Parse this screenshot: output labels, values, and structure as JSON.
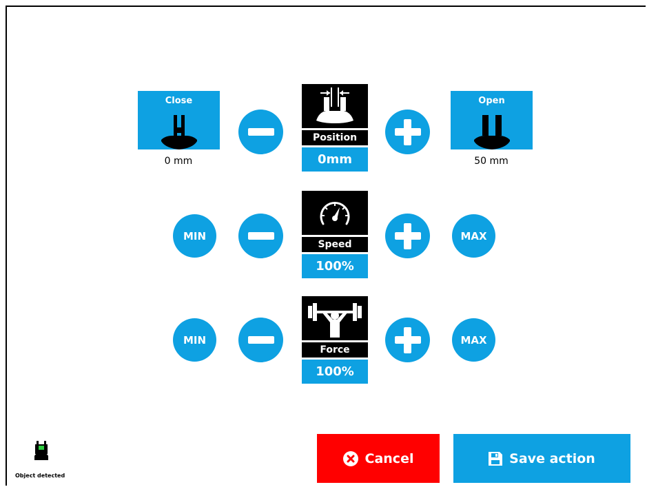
{
  "colors": {
    "accent": "#0ea1e2",
    "cancel": "#ff0000",
    "dark": "#000000"
  },
  "position": {
    "close_label": "Close",
    "open_label": "Open",
    "close_value": "0 mm",
    "open_value": "50 mm",
    "tile_name": "Position",
    "tile_value": "0mm",
    "icon": "gripper-width-icon"
  },
  "speed": {
    "min_label": "MIN",
    "max_label": "MAX",
    "tile_name": "Speed",
    "tile_value": "100%",
    "icon": "speedometer-icon"
  },
  "force": {
    "min_label": "MIN",
    "max_label": "MAX",
    "tile_name": "Force",
    "tile_value": "100%",
    "icon": "weightlifter-icon"
  },
  "footer": {
    "status_text": "Object detected",
    "cancel_label": "Cancel",
    "save_label": "Save action"
  }
}
